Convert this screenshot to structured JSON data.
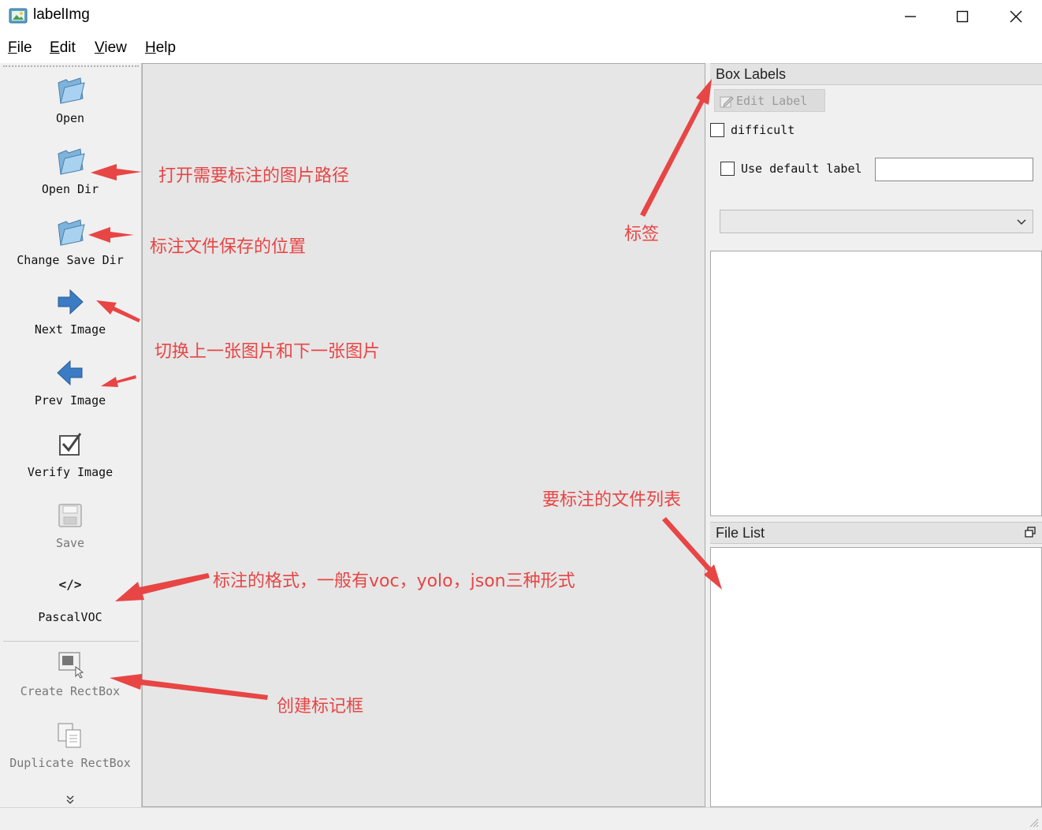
{
  "window": {
    "title": "labelImg",
    "controls": {
      "minimize": "minimize-icon",
      "maximize": "maximize-icon",
      "close": "close-icon"
    }
  },
  "menu": [
    {
      "label": "File",
      "mnemonic": "F",
      "rest": "ile"
    },
    {
      "label": "Edit",
      "mnemonic": "E",
      "rest": "dit"
    },
    {
      "label": "View",
      "mnemonic": "V",
      "rest": "iew"
    },
    {
      "label": "Help",
      "mnemonic": "H",
      "rest": "elp"
    }
  ],
  "toolbar": {
    "open": "Open",
    "open_dir": "Open Dir",
    "change_save_dir": "Change Save Dir",
    "next_image": "Next Image",
    "prev_image": "Prev Image",
    "verify_image": "Verify Image",
    "save": "Save",
    "format_icon": "</>",
    "format": "PascalVOC",
    "create_rectbox": "Create RectBox",
    "duplicate_rectbox": "Duplicate RectBox"
  },
  "box_labels": {
    "title": "Box Labels",
    "edit_label": "Edit Label",
    "difficult": "difficult",
    "use_default_label": "Use default label",
    "default_label_value": ""
  },
  "file_list": {
    "title": "File List"
  },
  "annotations": {
    "open_dir": "打开需要标注的图片路径",
    "save_dir": "标注文件保存的位置",
    "switch_image": "切换上一张图片和下一张图片",
    "format": "标注的格式，一般有voc，yolo，json三种形式",
    "create_box": "创建标记框",
    "labels": "标签",
    "file_list": "要标注的文件列表"
  },
  "colors": {
    "annotation": "#e84545",
    "canvas": "#e6e6e6",
    "panel": "#f0f0f0"
  }
}
